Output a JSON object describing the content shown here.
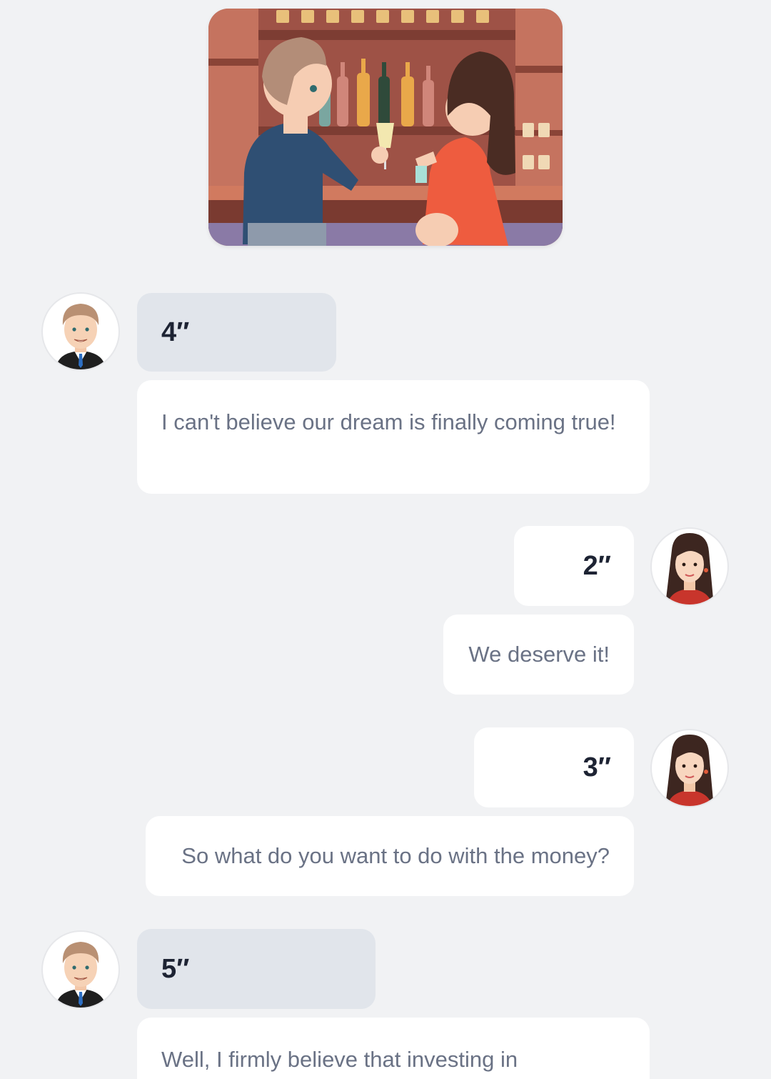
{
  "scene": {
    "description_icon": "bar-couple-illustration"
  },
  "messages": [
    {
      "speaker": "man",
      "side": "left",
      "duration": "4″",
      "text": "I can't believe our dream is finally coming true!"
    },
    {
      "speaker": "woman",
      "side": "right",
      "duration": "2″",
      "text": "We deserve it!"
    },
    {
      "speaker": "woman",
      "side": "right",
      "duration": "3″",
      "text": "So what do you want to do with the money?"
    },
    {
      "speaker": "man",
      "side": "left",
      "duration": "5″",
      "text": "Well, I firmly believe that investing in"
    }
  ],
  "colors": {
    "background": "#f1f2f4",
    "bubble_white": "#ffffff",
    "bubble_grey": "#e1e5eb",
    "duration_text": "#1d2333",
    "message_text": "#6a7285"
  }
}
